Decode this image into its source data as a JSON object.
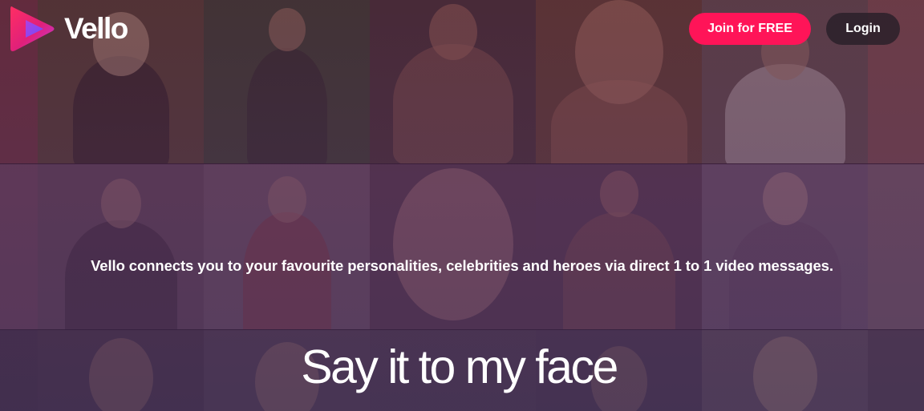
{
  "brand": {
    "name": "Vello",
    "logo_colors": [
      "#ff2e63",
      "#c13bd8",
      "#6d4dff"
    ]
  },
  "header": {
    "join_label": "Join for FREE",
    "login_label": "Login"
  },
  "hero": {
    "tagline": "Vello connects you to your favourite personalities, celebrities and heroes via direct 1 to 1 video messages.",
    "headline": "Say it to my face"
  },
  "colors": {
    "accent": "#ff1458",
    "overlay": "#4a2448"
  }
}
